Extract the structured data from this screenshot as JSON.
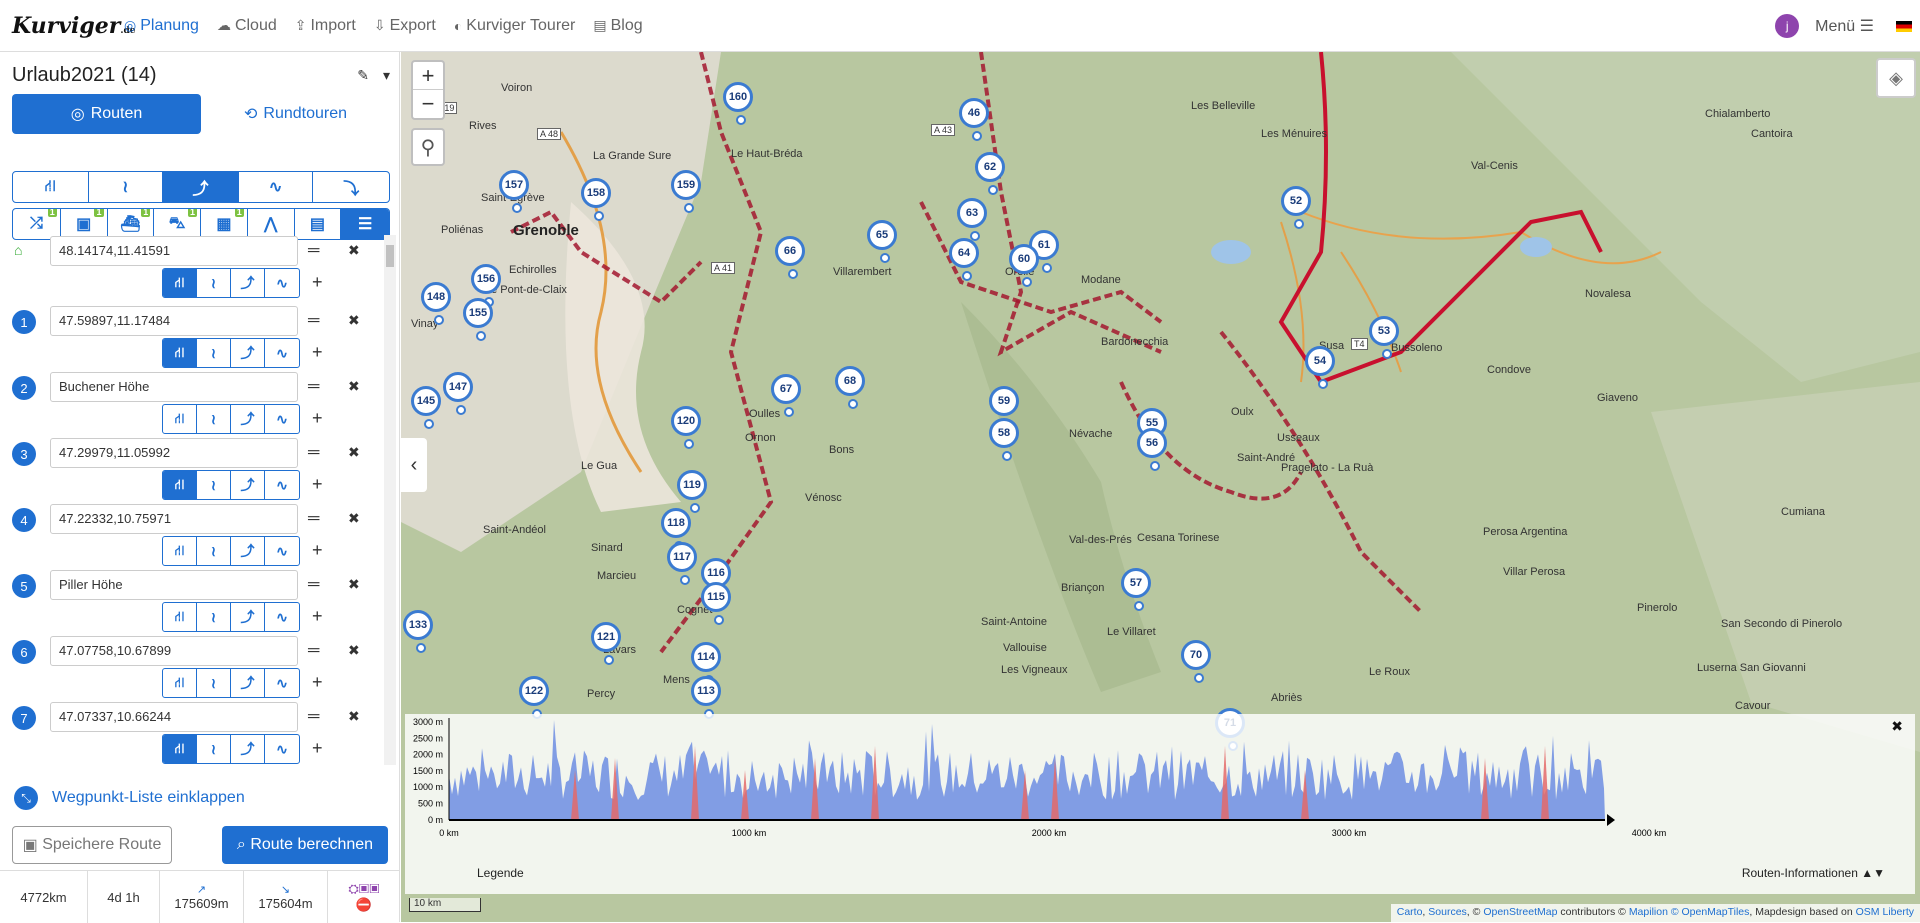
{
  "app": {
    "logo": "Kurviger",
    "logo_tld": ".de",
    "nav": [
      "Planung",
      "Cloud",
      "Import",
      "Export",
      "Kurviger Tourer",
      "Blog"
    ],
    "avatar_letter": "j",
    "menu_label": "Menü"
  },
  "sidebar": {
    "title": "Urlaub2021 (14)",
    "tab_routes": "Routen",
    "tab_round": "Rundtouren",
    "waypoints": [
      {
        "num": "",
        "value": "48.14174,11.41591",
        "home": true
      },
      {
        "num": "1",
        "value": "47.59897,11.17484"
      },
      {
        "num": "2",
        "value": "Buchener Höhe"
      },
      {
        "num": "3",
        "value": "47.29979,11.05992"
      },
      {
        "num": "4",
        "value": "47.22332,10.75971"
      },
      {
        "num": "5",
        "value": "Piller Höhe"
      },
      {
        "num": "6",
        "value": "47.07758,10.67899"
      },
      {
        "num": "7",
        "value": "47.07337,10.66244"
      }
    ],
    "collapse_label": "Wegpunkt-Liste einklappen",
    "save_label": "Speichere Route",
    "calc_label": "Route berechnen",
    "stats": {
      "distance": "4772km",
      "duration": "4d 1h",
      "ascent": "175609m",
      "descent": "175604m"
    }
  },
  "map": {
    "places": [
      {
        "name": "Grenoble",
        "big": true
      },
      {
        "name": "Voiron"
      },
      {
        "name": "Echirolles"
      },
      {
        "name": "Le Pont-de-Claix"
      },
      {
        "name": "Saint-Egrève"
      },
      {
        "name": "Les Belleville"
      },
      {
        "name": "Les Ménuires"
      },
      {
        "name": "Val-Cenis"
      },
      {
        "name": "Modane"
      },
      {
        "name": "Orelle"
      },
      {
        "name": "Bardonecchia"
      },
      {
        "name": "Oulx"
      },
      {
        "name": "Susa"
      },
      {
        "name": "Bussoleno"
      },
      {
        "name": "Condove"
      },
      {
        "name": "Giaveno"
      },
      {
        "name": "Pinerolo"
      },
      {
        "name": "Névache"
      },
      {
        "name": "Val-des-Prés"
      },
      {
        "name": "Cesana Torinese"
      },
      {
        "name": "Briançon"
      },
      {
        "name": "Vallouise"
      },
      {
        "name": "Les Vigneaux"
      },
      {
        "name": "Le Villaret"
      },
      {
        "name": "Saint-Antoine"
      },
      {
        "name": "Abriès"
      },
      {
        "name": "Le Roux"
      },
      {
        "name": "Mens"
      },
      {
        "name": "Percy"
      },
      {
        "name": "Lavars"
      },
      {
        "name": "Cognet"
      },
      {
        "name": "Sinard"
      },
      {
        "name": "Marcieu"
      },
      {
        "name": "Oulles"
      },
      {
        "name": "Ornon"
      },
      {
        "name": "Le Gua"
      },
      {
        "name": "Vénosc"
      },
      {
        "name": "Bons"
      },
      {
        "name": "Vinay"
      },
      {
        "name": "Poliénas"
      },
      {
        "name": "Rives"
      },
      {
        "name": "La Grande Sure"
      },
      {
        "name": "Le Haut-Bréda"
      },
      {
        "name": "Villarembert"
      },
      {
        "name": "Saint-André"
      },
      {
        "name": "Usseaux"
      },
      {
        "name": "Pragelato - La Ruà"
      },
      {
        "name": "Perosa Argentina"
      },
      {
        "name": "Villar Perosa"
      },
      {
        "name": "Cumiana"
      },
      {
        "name": "San Secondo di Pinerolo"
      },
      {
        "name": "Luserna San Giovanni"
      },
      {
        "name": "Cavour"
      },
      {
        "name": "Chialamberto"
      },
      {
        "name": "Cantoira"
      },
      {
        "name": "Novalesa"
      },
      {
        "name": "Saint-Andéol"
      }
    ],
    "pins": [
      "160",
      "157",
      "158",
      "159",
      "156",
      "148",
      "155",
      "145",
      "147",
      "133",
      "120",
      "119",
      "118",
      "117",
      "116",
      "115",
      "114",
      "113",
      "121",
      "122",
      "66",
      "65",
      "64",
      "63",
      "62",
      "61",
      "60",
      "59",
      "58",
      "67",
      "68",
      "46",
      "52",
      "53",
      "54",
      "55",
      "56",
      "57",
      "70",
      "71"
    ],
    "scale_label": "10 km",
    "attribution": [
      "Carto",
      "Sources",
      "©",
      "OpenStreetMap",
      "contributors ©",
      "Mapilion",
      "© OpenMapTiles",
      ", Mapdesign based on",
      "OSM Liberty"
    ]
  },
  "elevation": {
    "y_ticks": [
      "3000 m",
      "2500 m",
      "2000 m",
      "1500 m",
      "1000 m",
      "500 m",
      "0 m"
    ],
    "x_ticks": [
      "0 km",
      "1000 km",
      "2000 km",
      "3000 km",
      "4000 km"
    ],
    "legend_label": "Legende",
    "route_info_label": "Routen-Informationen"
  }
}
